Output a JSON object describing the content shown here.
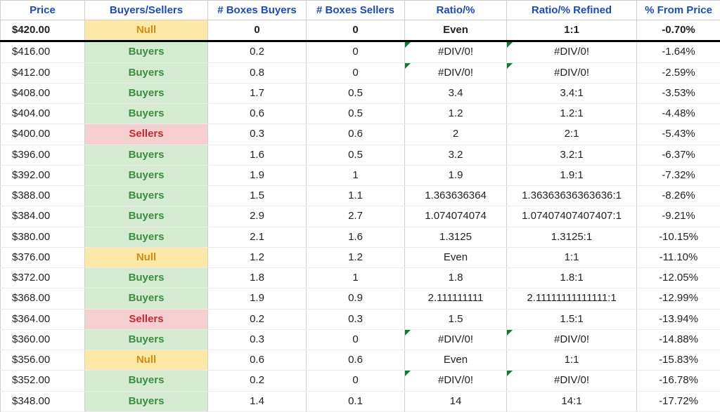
{
  "columns": [
    {
      "key": "price",
      "label": "Price"
    },
    {
      "key": "bs",
      "label": "Buyers/Sellers"
    },
    {
      "key": "boxes_buyers",
      "label": "# Boxes Buyers"
    },
    {
      "key": "boxes_sellers",
      "label": "# Boxes Sellers"
    },
    {
      "key": "ratio",
      "label": "Ratio/%"
    },
    {
      "key": "ratio_refined",
      "label": "Ratio/% Refined"
    },
    {
      "key": "from_price",
      "label": "% From Price"
    }
  ],
  "highlight_row_index": 0,
  "rows": [
    {
      "price": "$420.00",
      "bs": "Null",
      "boxes_buyers": "0",
      "boxes_sellers": "0",
      "ratio": "Even",
      "ratio_refined": "1:1",
      "from_price": "-0.70%",
      "ratio_err": false,
      "refined_err": false
    },
    {
      "price": "$416.00",
      "bs": "Buyers",
      "boxes_buyers": "0.2",
      "boxes_sellers": "0",
      "ratio": "#DIV/0!",
      "ratio_refined": "#DIV/0!",
      "from_price": "-1.64%",
      "ratio_err": true,
      "refined_err": true
    },
    {
      "price": "$412.00",
      "bs": "Buyers",
      "boxes_buyers": "0.8",
      "boxes_sellers": "0",
      "ratio": "#DIV/0!",
      "ratio_refined": "#DIV/0!",
      "from_price": "-2.59%",
      "ratio_err": true,
      "refined_err": true
    },
    {
      "price": "$408.00",
      "bs": "Buyers",
      "boxes_buyers": "1.7",
      "boxes_sellers": "0.5",
      "ratio": "3.4",
      "ratio_refined": "3.4:1",
      "from_price": "-3.53%",
      "ratio_err": false,
      "refined_err": false
    },
    {
      "price": "$404.00",
      "bs": "Buyers",
      "boxes_buyers": "0.6",
      "boxes_sellers": "0.5",
      "ratio": "1.2",
      "ratio_refined": "1.2:1",
      "from_price": "-4.48%",
      "ratio_err": false,
      "refined_err": false
    },
    {
      "price": "$400.00",
      "bs": "Sellers",
      "boxes_buyers": "0.3",
      "boxes_sellers": "0.6",
      "ratio": "2",
      "ratio_refined": "2:1",
      "from_price": "-5.43%",
      "ratio_err": false,
      "refined_err": false
    },
    {
      "price": "$396.00",
      "bs": "Buyers",
      "boxes_buyers": "1.6",
      "boxes_sellers": "0.5",
      "ratio": "3.2",
      "ratio_refined": "3.2:1",
      "from_price": "-6.37%",
      "ratio_err": false,
      "refined_err": false
    },
    {
      "price": "$392.00",
      "bs": "Buyers",
      "boxes_buyers": "1.9",
      "boxes_sellers": "1",
      "ratio": "1.9",
      "ratio_refined": "1.9:1",
      "from_price": "-7.32%",
      "ratio_err": false,
      "refined_err": false
    },
    {
      "price": "$388.00",
      "bs": "Buyers",
      "boxes_buyers": "1.5",
      "boxes_sellers": "1.1",
      "ratio": "1.363636364",
      "ratio_refined": "1.36363636363636:1",
      "from_price": "-8.26%",
      "ratio_err": false,
      "refined_err": false
    },
    {
      "price": "$384.00",
      "bs": "Buyers",
      "boxes_buyers": "2.9",
      "boxes_sellers": "2.7",
      "ratio": "1.074074074",
      "ratio_refined": "1.07407407407407:1",
      "from_price": "-9.21%",
      "ratio_err": false,
      "refined_err": false
    },
    {
      "price": "$380.00",
      "bs": "Buyers",
      "boxes_buyers": "2.1",
      "boxes_sellers": "1.6",
      "ratio": "1.3125",
      "ratio_refined": "1.3125:1",
      "from_price": "-10.15%",
      "ratio_err": false,
      "refined_err": false
    },
    {
      "price": "$376.00",
      "bs": "Null",
      "boxes_buyers": "1.2",
      "boxes_sellers": "1.2",
      "ratio": "Even",
      "ratio_refined": "1:1",
      "from_price": "-11.10%",
      "ratio_err": false,
      "refined_err": false
    },
    {
      "price": "$372.00",
      "bs": "Buyers",
      "boxes_buyers": "1.8",
      "boxes_sellers": "1",
      "ratio": "1.8",
      "ratio_refined": "1.8:1",
      "from_price": "-12.05%",
      "ratio_err": false,
      "refined_err": false
    },
    {
      "price": "$368.00",
      "bs": "Buyers",
      "boxes_buyers": "1.9",
      "boxes_sellers": "0.9",
      "ratio": "2.111111111",
      "ratio_refined": "2.11111111111111:1",
      "from_price": "-12.99%",
      "ratio_err": false,
      "refined_err": false
    },
    {
      "price": "$364.00",
      "bs": "Sellers",
      "boxes_buyers": "0.2",
      "boxes_sellers": "0.3",
      "ratio": "1.5",
      "ratio_refined": "1.5:1",
      "from_price": "-13.94%",
      "ratio_err": false,
      "refined_err": false
    },
    {
      "price": "$360.00",
      "bs": "Buyers",
      "boxes_buyers": "0.3",
      "boxes_sellers": "0",
      "ratio": "#DIV/0!",
      "ratio_refined": "#DIV/0!",
      "from_price": "-14.88%",
      "ratio_err": true,
      "refined_err": true
    },
    {
      "price": "$356.00",
      "bs": "Null",
      "boxes_buyers": "0.6",
      "boxes_sellers": "0.6",
      "ratio": "Even",
      "ratio_refined": "1:1",
      "from_price": "-15.83%",
      "ratio_err": false,
      "refined_err": false
    },
    {
      "price": "$352.00",
      "bs": "Buyers",
      "boxes_buyers": "0.2",
      "boxes_sellers": "0",
      "ratio": "#DIV/0!",
      "ratio_refined": "#DIV/0!",
      "from_price": "-16.78%",
      "ratio_err": true,
      "refined_err": true
    },
    {
      "price": "$348.00",
      "bs": "Buyers",
      "boxes_buyers": "1.4",
      "boxes_sellers": "0.1",
      "ratio": "14",
      "ratio_refined": "14:1",
      "from_price": "-17.72%",
      "ratio_err": false,
      "refined_err": false
    }
  ],
  "bs_styles": {
    "Buyers": "bs-buyers",
    "Sellers": "bs-sellers",
    "Null": "bs-null"
  }
}
